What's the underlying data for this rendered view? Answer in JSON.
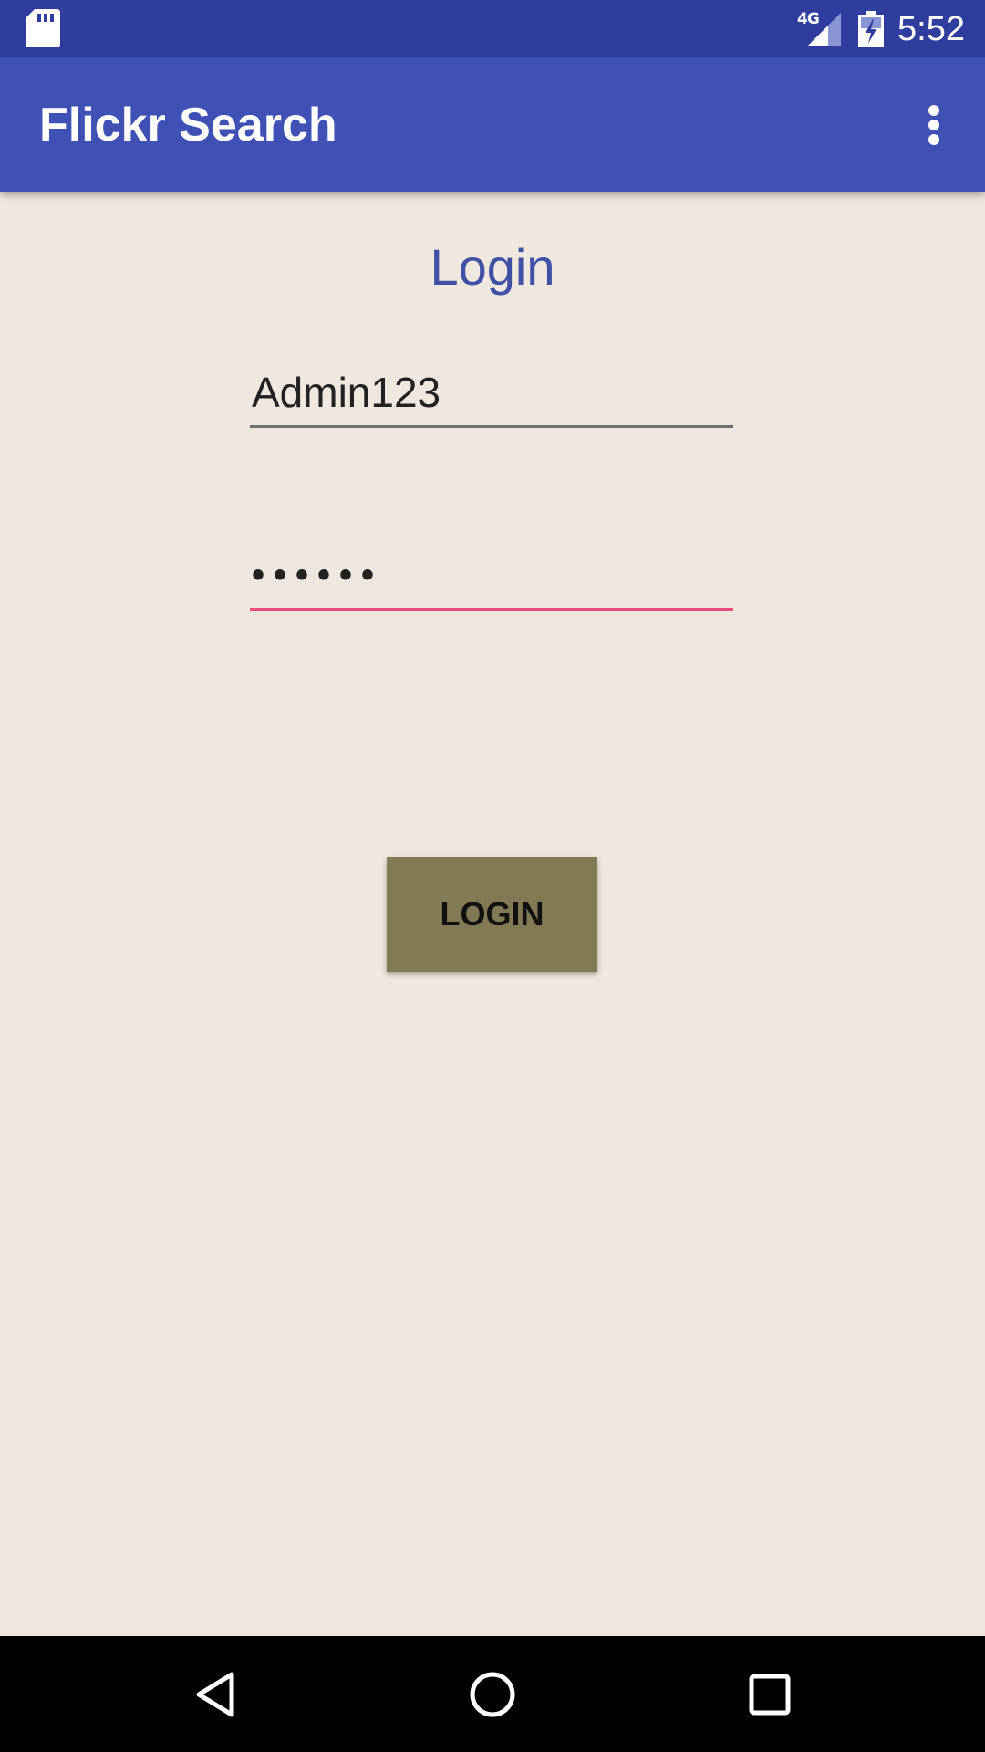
{
  "status_bar": {
    "network_type": "4G",
    "time": "5:52",
    "icons": [
      "sd-card-icon",
      "cell-signal-icon",
      "battery-charging-icon"
    ]
  },
  "app_bar": {
    "title": "Flickr Search",
    "overflow_icon": "more-vert-icon"
  },
  "login_form": {
    "heading": "Login",
    "username_value": "Admin123",
    "password_value": "••••••",
    "submit_label": "LOGIN"
  },
  "nav_bar": {
    "buttons": [
      "back-icon",
      "home-icon",
      "recents-icon"
    ]
  },
  "colors": {
    "status_bar": "#2f3e9e",
    "app_bar": "#3f51b5",
    "background": "#f0e8df",
    "heading": "#3f51a5",
    "focused_underline": "#ef4a7e",
    "button": "#837a55"
  }
}
